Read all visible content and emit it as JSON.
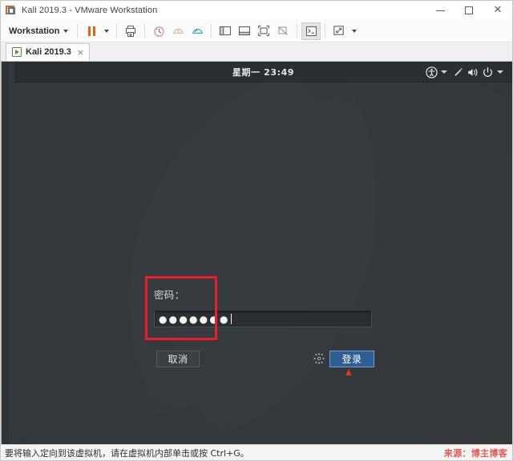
{
  "window": {
    "title": "Kali 2019.3 - VMware Workstation",
    "icon": "vmware-logo-icon",
    "controls": {
      "minimize": "minimize-icon",
      "maximize": "maximize-icon",
      "close": "close-icon"
    }
  },
  "toolbar": {
    "menu_label": "Workstation",
    "items": [
      {
        "name": "pause-vm-button",
        "icon": "pause-icon"
      },
      {
        "name": "pause-dropdown-button",
        "icon": "chevron-down-icon"
      },
      {
        "name": "send-ctrl-alt-del-button",
        "icon": "printer-download-icon"
      },
      {
        "name": "snapshot-take-button",
        "icon": "clock-snapshot-icon"
      },
      {
        "name": "snapshot-revert-button",
        "icon": "revert-snapshot-icon"
      },
      {
        "name": "snapshot-manager-button",
        "icon": "snapshot-manager-icon"
      },
      {
        "name": "show-library-button",
        "icon": "sidebar-panel-icon"
      },
      {
        "name": "show-thumbnail-bar-button",
        "icon": "bottom-panel-icon"
      },
      {
        "name": "full-screen-button",
        "icon": "fullscreen-icon"
      },
      {
        "name": "unity-mode-button",
        "icon": "unity-mode-icon"
      },
      {
        "name": "console-view-button",
        "icon": "terminal-icon"
      },
      {
        "name": "stretch-guest-button",
        "icon": "expand-arrows-icon"
      },
      {
        "name": "stretch-dropdown-button",
        "icon": "chevron-down-icon"
      }
    ]
  },
  "tabs": [
    {
      "label": "Kali 2019.3",
      "icon": "vm-power-on-icon",
      "close": "×",
      "active": true
    }
  ],
  "guest": {
    "topbar": {
      "clock": "星期一 23:49",
      "tray": [
        {
          "name": "accessibility-icon",
          "glyph": "accessibility"
        },
        {
          "name": "accessibility-menu-caret-icon",
          "glyph": "caret"
        },
        {
          "name": "screen-brightness-icon",
          "glyph": "pen"
        },
        {
          "name": "volume-icon",
          "glyph": "speaker"
        },
        {
          "name": "power-icon",
          "glyph": "power"
        },
        {
          "name": "system-menu-caret-icon",
          "glyph": "caret"
        }
      ]
    },
    "login": {
      "password_label": "密码：",
      "password_value": "●●●●●●●",
      "password_placeholder": "",
      "cancel_label": "取消",
      "login_label": "登录",
      "session_gear_icon": "gear-icon"
    }
  },
  "annotations": {
    "highlight_box": "red-highlight-rectangle",
    "arrow": "red-up-arrow"
  },
  "statusbar": {
    "message": "要将输入定向到该虚拟机，请在虚拟机内部单击或按 Ctrl+G。",
    "watermark": "来源：博主博客"
  },
  "colors": {
    "accent_orange": "#e8621a",
    "login_blue": "#2e5f92",
    "annotation_red": "#ee1c25",
    "desktop_bg": "#32373b",
    "gnome_bar": "#2b2f33"
  }
}
